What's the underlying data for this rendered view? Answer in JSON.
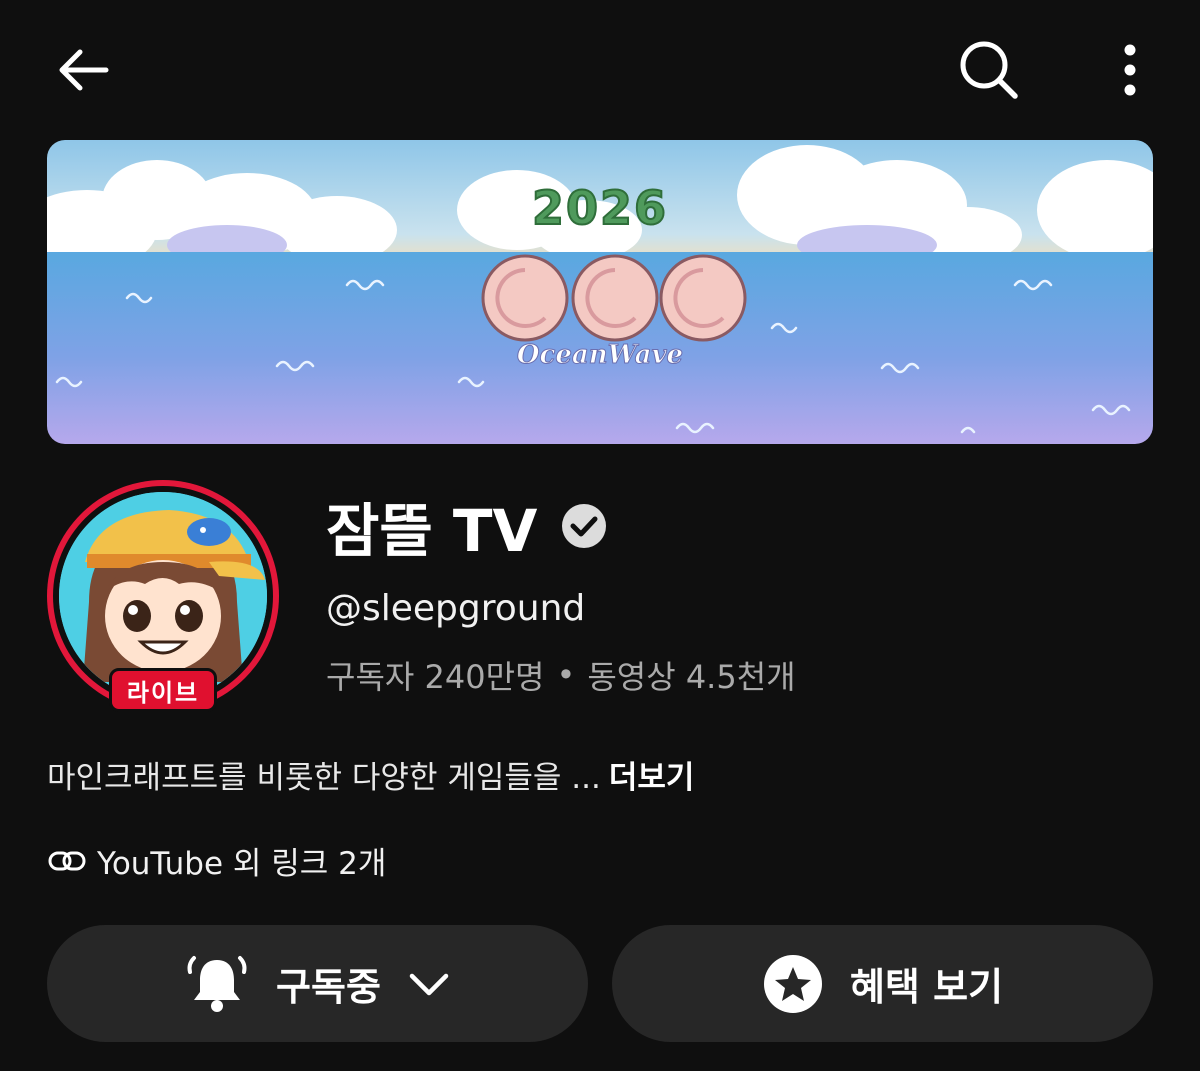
{
  "icons": {
    "back": "arrow-left-icon",
    "search": "search-icon",
    "more": "more-vertical-icon",
    "verified": "verified-check-icon",
    "link": "link-icon",
    "bell": "bell-icon",
    "chevron": "chevron-down-icon",
    "star": "star-icon"
  },
  "banner": {
    "year": "2026",
    "logo_text": "OGG",
    "subtitle": "OceanWave"
  },
  "channel": {
    "name": "잠뜰 TV",
    "handle": "@sleepground",
    "subscribers": "구독자 240만명",
    "separator": "•",
    "videos": "동영상 4.5천개",
    "live_badge": "라이브",
    "description": "마인크래프트를 비롯한 다양한 게임들을 ...",
    "more_label": "더보기",
    "links_text": "YouTube 외 링크 2개"
  },
  "actions": {
    "subscribed_label": "구독중",
    "benefits_label": "혜택 보기"
  },
  "colors": {
    "background": "#0f0f0f",
    "button_bg": "#272727",
    "live_red": "#e0102f",
    "secondary_text": "#aaaaaa"
  }
}
